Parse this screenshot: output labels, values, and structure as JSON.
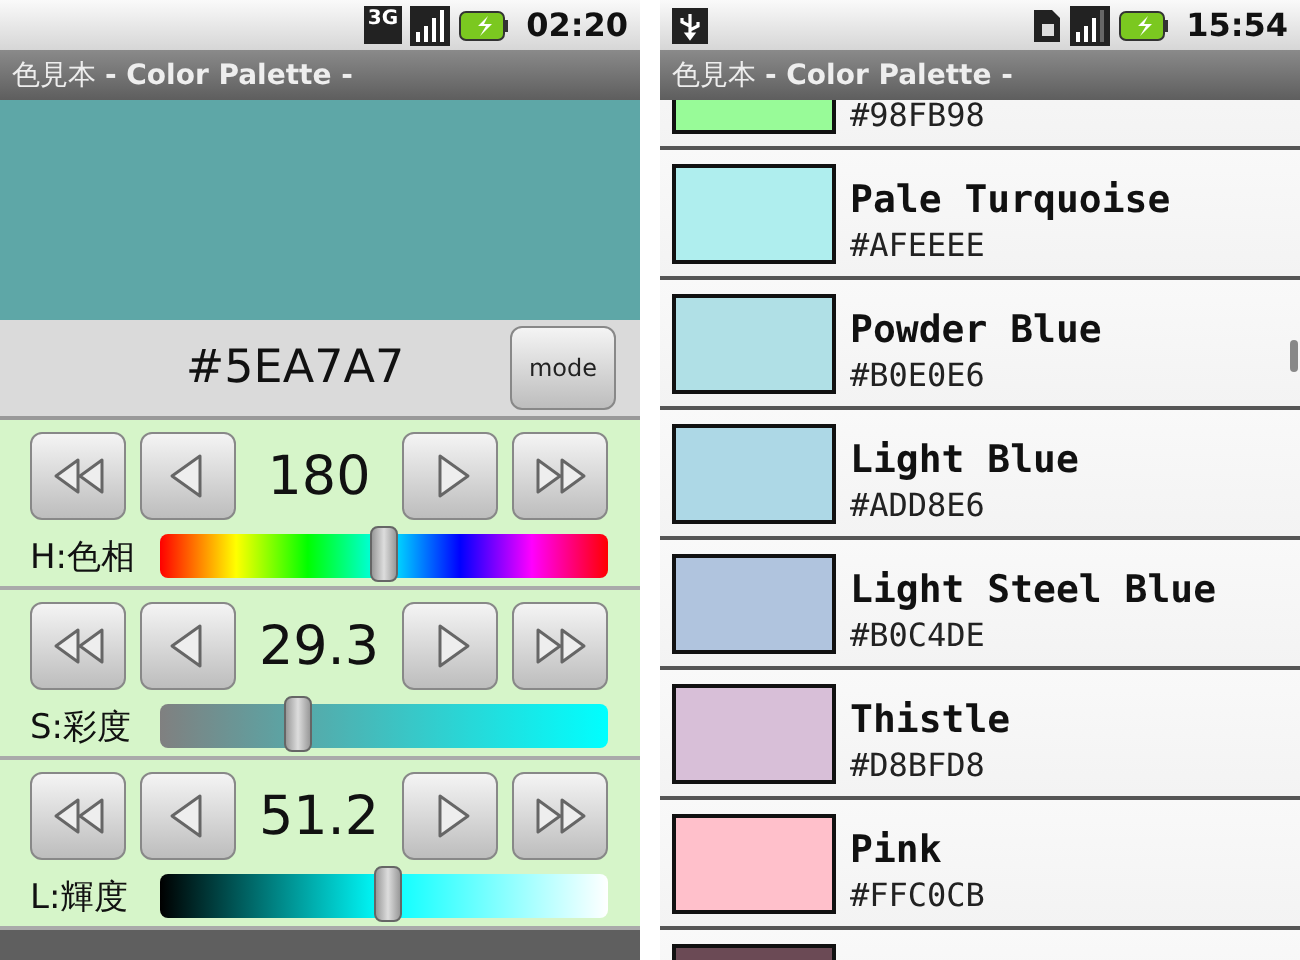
{
  "screens": [
    {
      "kind": "editor",
      "status_bar": {
        "network": "3G",
        "time": "02:20"
      },
      "title": "色見本 **- Color Palette -**",
      "preview": {
        "color": "#5ea7a7"
      },
      "hex_code": "#5EA7A7",
      "mode_button": "mode",
      "channels": [
        {
          "kind": "hue",
          "value": "180",
          "label": "H:色相",
          "level": 0.5
        },
        {
          "kind": "saturation",
          "value": "29.3",
          "label": "S:彩度",
          "level": 0.31
        },
        {
          "kind": "lightness",
          "value": "51.2",
          "label": "L:輝度",
          "level": 0.51
        }
      ]
    },
    {
      "kind": "list",
      "status_bar": {
        "time": "15:54"
      },
      "title": "色見本 **- Color Palette -**",
      "items": [
        {
          "hex": "#98FB98",
          "color": "#98fb98"
        },
        {
          "name": "Pale Turquoise",
          "hex": "#AFEEEE",
          "color": "#afeeee"
        },
        {
          "name": "Powder Blue",
          "hex": "#B0E0E6",
          "color": "#b0e0e6"
        },
        {
          "name": "Light Blue",
          "hex": "#ADD8E6",
          "color": "#add8e6"
        },
        {
          "name": "Light Steel Blue",
          "hex": "#B0C4DE",
          "color": "#b0c4de"
        },
        {
          "name": "Thistle",
          "hex": "#D8BFD8",
          "color": "#d8bfd8"
        },
        {
          "name": "Pink",
          "hex": "#FFC0CB",
          "color": "#ffc0cb"
        },
        {
          "color": "#6b4a55"
        }
      ]
    }
  ]
}
